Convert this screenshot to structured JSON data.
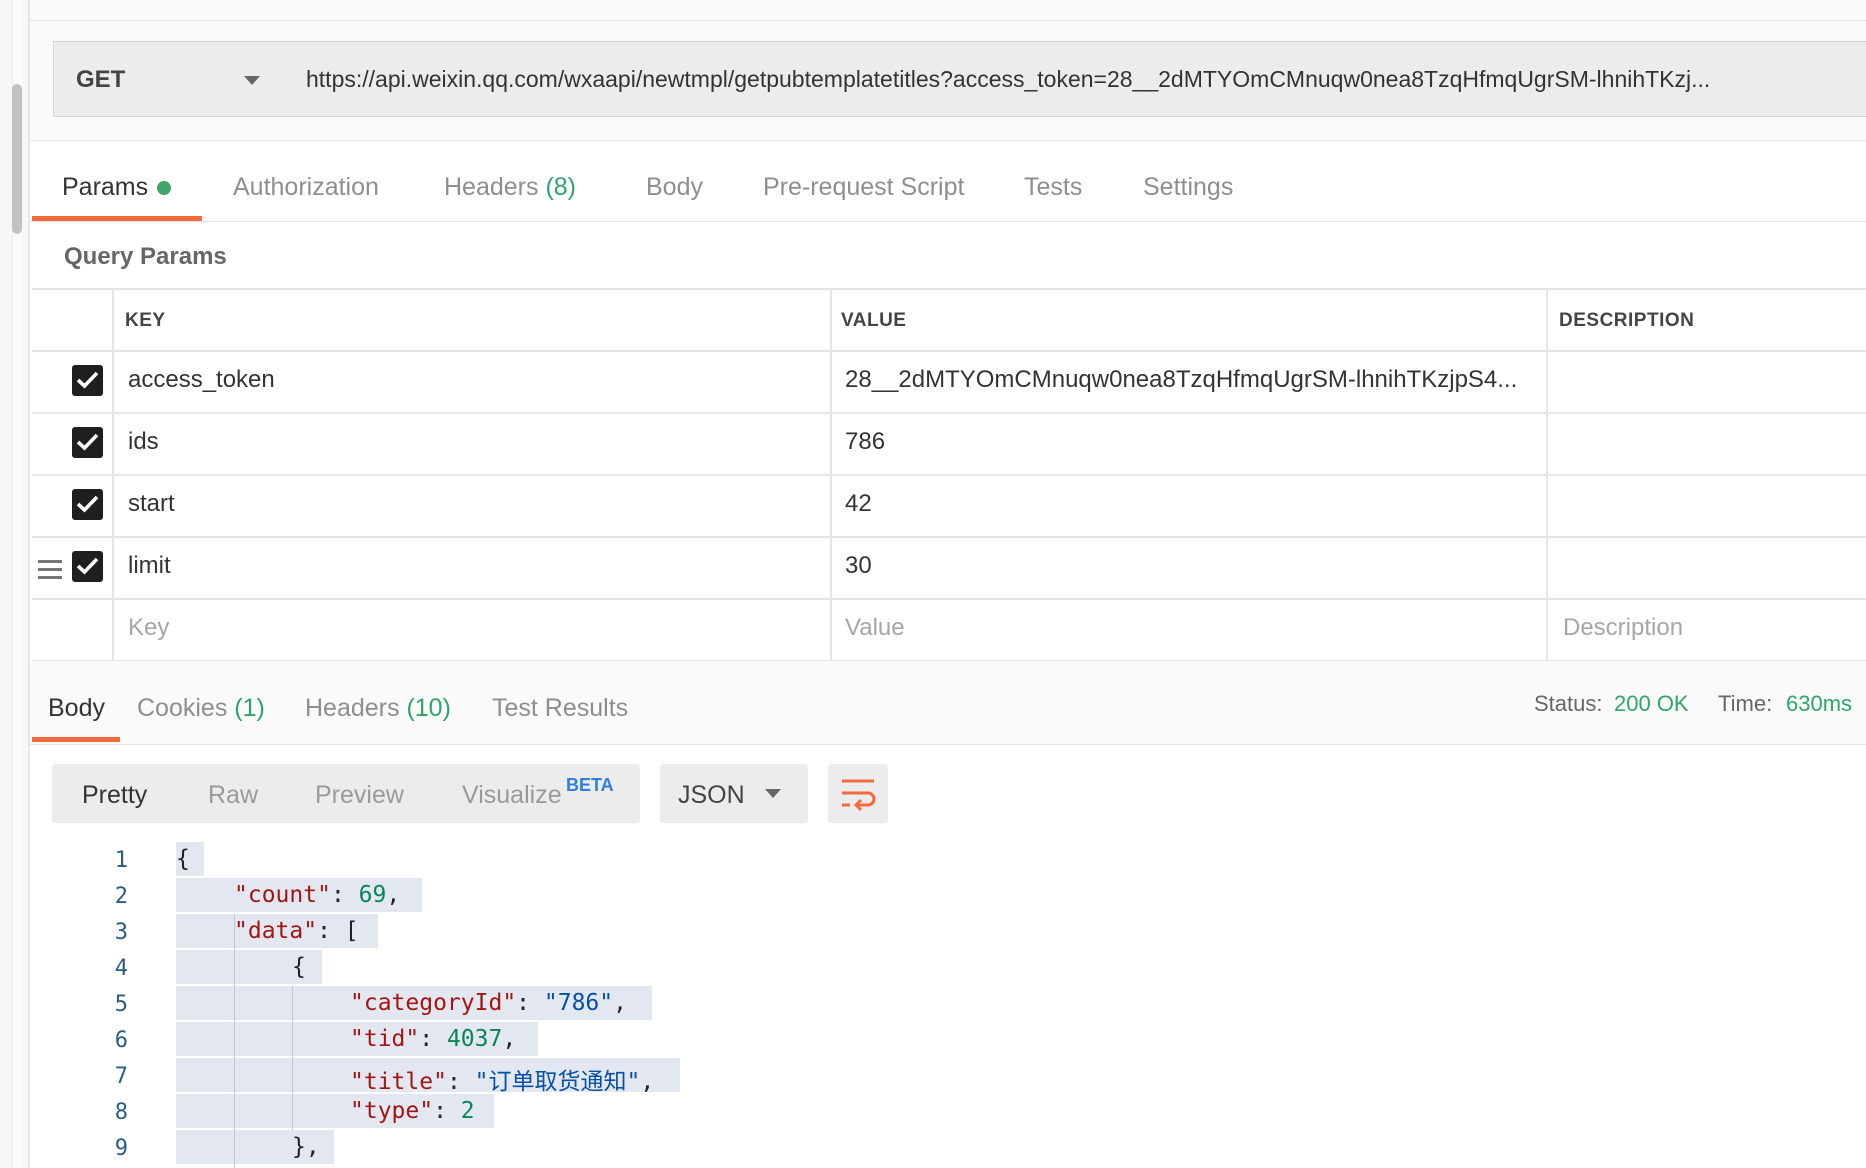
{
  "request": {
    "method": "GET",
    "url": "https://api.weixin.qq.com/wxaapi/newtmpl/getpubtemplatetitles?access_token=28__2dMTYOmCMnuqw0nea8TzqHfmqUgrSM-lhnihTKzj..."
  },
  "request_tabs": [
    {
      "label": "Params",
      "count": ""
    },
    {
      "label": "Authorization",
      "count": ""
    },
    {
      "label": "Headers",
      "count": "(8)"
    },
    {
      "label": "Body",
      "count": ""
    },
    {
      "label": "Pre-request Script",
      "count": ""
    },
    {
      "label": "Tests",
      "count": ""
    },
    {
      "label": "Settings",
      "count": ""
    }
  ],
  "query_params": {
    "title": "Query Params",
    "columns": [
      "KEY",
      "VALUE",
      "DESCRIPTION"
    ],
    "rows": [
      {
        "checked": true,
        "key": "access_token",
        "value": "28__2dMTYOmCMnuqw0nea8TzqHfmqUgrSM-lhnihTKzjpS4...",
        "description": ""
      },
      {
        "checked": true,
        "key": "ids",
        "value": "786",
        "description": ""
      },
      {
        "checked": true,
        "key": "start",
        "value": "42",
        "description": ""
      },
      {
        "checked": true,
        "key": "limit",
        "value": "30",
        "description": ""
      }
    ],
    "placeholders": {
      "key": "Key",
      "value": "Value",
      "description": "Description"
    }
  },
  "response_tabs": [
    {
      "label": "Body",
      "count": ""
    },
    {
      "label": "Cookies",
      "count": "(1)"
    },
    {
      "label": "Headers",
      "count": "(10)"
    },
    {
      "label": "Test Results",
      "count": ""
    }
  ],
  "status": {
    "label": "Status:",
    "value": "200 OK",
    "time_label": "Time:",
    "time_value": "630ms"
  },
  "view_modes": [
    "Pretty",
    "Raw",
    "Preview",
    "Visualize"
  ],
  "beta_badge": "BETA",
  "format": "JSON",
  "code_lines": [
    {
      "n": "1",
      "tokens": [
        {
          "t": "p",
          "v": "{"
        }
      ]
    },
    {
      "n": "2",
      "tokens": [
        {
          "t": "k",
          "v": "\"count\""
        },
        {
          "t": "p",
          "v": ": "
        },
        {
          "t": "n",
          "v": "69"
        },
        {
          "t": "p",
          "v": ","
        }
      ]
    },
    {
      "n": "3",
      "tokens": [
        {
          "t": "k",
          "v": "\"data\""
        },
        {
          "t": "p",
          "v": ": ["
        }
      ]
    },
    {
      "n": "4",
      "tokens": [
        {
          "t": "p",
          "v": "{"
        }
      ]
    },
    {
      "n": "5",
      "tokens": [
        {
          "t": "k",
          "v": "\"categoryId\""
        },
        {
          "t": "p",
          "v": ": "
        },
        {
          "t": "s",
          "v": "\"786\""
        },
        {
          "t": "p",
          "v": ","
        }
      ]
    },
    {
      "n": "6",
      "tokens": [
        {
          "t": "k",
          "v": "\"tid\""
        },
        {
          "t": "p",
          "v": ": "
        },
        {
          "t": "n",
          "v": "4037"
        },
        {
          "t": "p",
          "v": ","
        }
      ]
    },
    {
      "n": "7",
      "tokens": [
        {
          "t": "k",
          "v": "\"title\""
        },
        {
          "t": "p",
          "v": ": "
        },
        {
          "t": "s",
          "v": "\"订单取货通知\""
        },
        {
          "t": "p",
          "v": ","
        }
      ]
    },
    {
      "n": "8",
      "tokens": [
        {
          "t": "k",
          "v": "\"type\""
        },
        {
          "t": "p",
          "v": ": "
        },
        {
          "t": "n",
          "v": "2"
        }
      ]
    },
    {
      "n": "9",
      "tokens": [
        {
          "t": "p",
          "v": "},"
        }
      ]
    }
  ],
  "colors": {
    "accent": "#f26b3a",
    "count_green": "#2ea56a"
  }
}
